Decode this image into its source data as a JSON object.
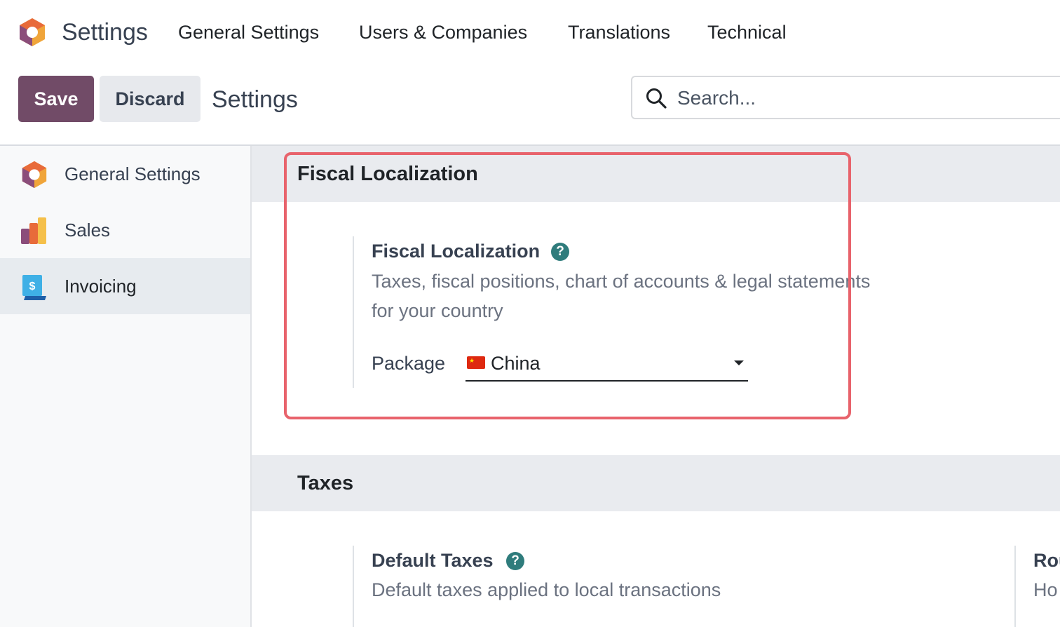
{
  "app": {
    "name": "Settings"
  },
  "nav": {
    "items": [
      {
        "label": "General Settings"
      },
      {
        "label": "Users & Companies"
      },
      {
        "label": "Translations"
      },
      {
        "label": "Technical"
      }
    ]
  },
  "control": {
    "save_label": "Save",
    "discard_label": "Discard",
    "title": "Settings",
    "search_placeholder": "Search..."
  },
  "sidebar": {
    "items": [
      {
        "label": "General Settings",
        "icon": "odoo-logo-icon"
      },
      {
        "label": "Sales",
        "icon": "sales-chart-icon"
      },
      {
        "label": "Invoicing",
        "icon": "invoice-dollar-icon",
        "active": true
      }
    ]
  },
  "sections": {
    "fiscal": {
      "title": "Fiscal Localization",
      "setting": {
        "title": "Fiscal Localization",
        "description_line1": "Taxes, fiscal positions, chart of accounts & legal statements",
        "description_line2": "for your country",
        "package_label": "Package",
        "package_value": "China"
      }
    },
    "taxes": {
      "title": "Taxes",
      "default_taxes": {
        "title": "Default Taxes",
        "description": "Default taxes applied to local transactions"
      },
      "second_setting": {
        "title": "Rou",
        "description": "Ho"
      }
    }
  },
  "colors": {
    "brand": "#714b67",
    "highlight": "#e8636c",
    "help": "#2f7c7c"
  }
}
